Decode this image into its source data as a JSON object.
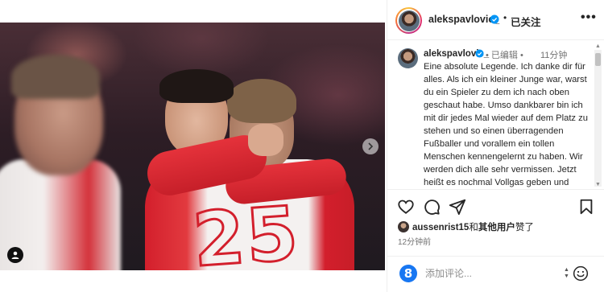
{
  "post": {
    "username": "alekspavlovic_",
    "follow_status": "已关注",
    "separator": "•",
    "more": "•••",
    "jersey_number": "25"
  },
  "caption": {
    "username": "alekspavlovic_",
    "edited": "• 已编辑 •",
    "time_ago": "11分钟",
    "text": "Eine absolute Legende. Ich danke dir für alles. Als ich ein kleiner Junge war, warst du ein Spieler zu dem ich nach oben geschaut habe. Umso dankbarer bin ich mit dir jedes Mal wieder auf dem Platz zu stehen und so einen überragenden Fußballer und vorallem ein tollen Menschen kennengelernt zu haben. Wir werden dich alle sehr vermissen. Jetzt heißt es nochmal Vollgas geben und"
  },
  "likes": {
    "user": "aussenrist15",
    "mid": "和",
    "others": "其他用户",
    "suffix": "赞了"
  },
  "timestamp": "12分钟前",
  "add_comment": {
    "placeholder": "添加评论...",
    "sticker": "8"
  },
  "icons": {
    "like": "heart-icon",
    "comment": "comment-icon",
    "share": "share-icon",
    "save": "bookmark-icon",
    "emoji": "emoji-icon",
    "next": "chevron-right-icon",
    "tag": "user-tag-icon",
    "verified": "verified-badge-icon"
  },
  "colors": {
    "verified": "#0095f6",
    "sticker": "#1877f2",
    "jersey_red": "#d31f2c"
  }
}
